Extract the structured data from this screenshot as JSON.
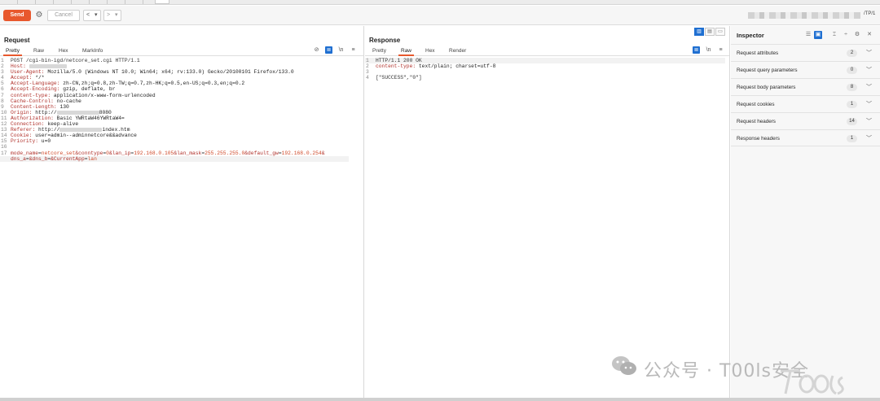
{
  "toolbar": {
    "send_label": "Send",
    "cancel_label": "Cancel",
    "back_label": "<",
    "back_arrow": "▾",
    "fwd_label": ">",
    "fwd_arrow": "▾",
    "target_suffix": "/TP/1"
  },
  "request": {
    "title": "Request",
    "tabs": [
      "Pretty",
      "Raw",
      "Hex",
      "MarkInfo"
    ],
    "active_tab": "Pretty",
    "lines": {
      "l1": "POST /cgi-bin-igd/netcore_set.cgi HTTP/1.1",
      "l2_key": "Host:",
      "l3_key": "User-Agent:",
      "l3_val": " Mozilla/5.0 (Windows NT 10.0; Win64; x64; rv:133.0) Gecko/20100101 Firefox/133.0",
      "l4_key": "Accept:",
      "l4_val": " */*",
      "l5_key": "Accept-Language:",
      "l5_val": " zh-CN,zh;q=0.8,zh-TW;q=0.7,zh-HK;q=0.5,en-US;q=0.3,en;q=0.2",
      "l6_key": "Accept-Encoding:",
      "l6_val": " gzip, deflate, br",
      "l7_key": "content-type:",
      "l7_val": " application/x-www-form-urlencoded",
      "l8_key": "Cache-Control:",
      "l8_val": " no-cache",
      "l9_key": "Content-Length:",
      "l9_val": " 130",
      "l10_key": "Origin:",
      "l10_val": " http://",
      "l10_tail": "8080",
      "l11_key": "Authorization:",
      "l11_val": " Basic YWRtaW46YWRtaW4=",
      "l12_key": "Connection:",
      "l12_val": " keep-alive",
      "l13_key": "Referer:",
      "l13_val": " http://",
      "l13_tail": "index.htm",
      "l14_key": "Cookie:",
      "l14_val": " user=admin--adminnetcore&&advance",
      "l15_key": "Priority:",
      "l15_val": " u=0",
      "body1": {
        "p1": "mode_name",
        "v1": "netcore_set",
        "p2": "&conntype",
        "v2": "0",
        "p3": "&lan_ip",
        "v3": "192.168.0.105",
        "p4": "&lan_mask",
        "v4": "255.255.255.0",
        "p5": "&default_gw",
        "v5": "192.168.0.254",
        "tail": "&"
      },
      "body2": {
        "p1": "dns_a",
        "p2": "&dns_b",
        "p3": "&CurrentApp",
        "v3": "lan"
      }
    }
  },
  "response": {
    "title": "Response",
    "tabs": [
      "Pretty",
      "Raw",
      "Hex",
      "Render"
    ],
    "active_tab": "Raw",
    "lines": {
      "l1": "HTTP/1.1 200 OK",
      "l2_key": "content-type:",
      "l2_val": " text/plain; charset=utf-8",
      "l4": "[\"SUCCESS\",\"0\"]"
    }
  },
  "inspector": {
    "title": "Inspector",
    "rows": [
      {
        "label": "Request attributes",
        "count": "2"
      },
      {
        "label": "Request query parameters",
        "count": "0"
      },
      {
        "label": "Request body parameters",
        "count": "8"
      },
      {
        "label": "Request cookies",
        "count": "1"
      },
      {
        "label": "Request headers",
        "count": "14"
      },
      {
        "label": "Response headers",
        "count": "1"
      }
    ]
  },
  "watermark": {
    "text": "公众号 · T00ls安全"
  },
  "colors": {
    "accent": "#e8582d",
    "toggle_blue": "#1f6fd1"
  }
}
